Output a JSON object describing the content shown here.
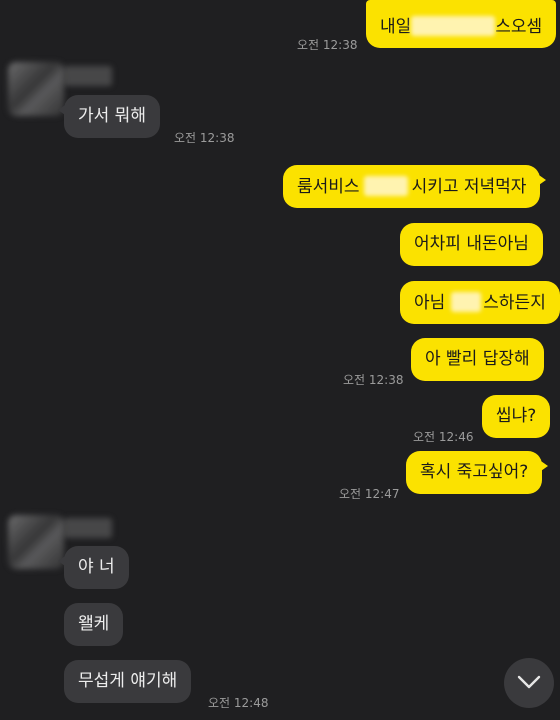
{
  "messages": [
    {
      "side": "me",
      "parts": [
        "내일",
        "",
        "스오셈"
      ],
      "time": "오전 12:38"
    },
    {
      "side": "other",
      "text": "가서 뭐해",
      "time": "오전 12:38"
    },
    {
      "side": "me",
      "parts": [
        "룸서비스",
        "",
        "시키고 저녁먹자"
      ]
    },
    {
      "side": "me",
      "text": "어차피 내돈아님"
    },
    {
      "side": "me",
      "parts": [
        "아님",
        "",
        "스하든지"
      ]
    },
    {
      "side": "me",
      "text": "아 빨리 답장해",
      "time": "오전 12:38"
    },
    {
      "side": "me",
      "text": "씹냐?",
      "time": "오전 12:46"
    },
    {
      "side": "me",
      "text": "혹시 죽고싶어?",
      "time": "오전 12:47"
    },
    {
      "side": "other",
      "text": "야 너"
    },
    {
      "side": "other",
      "text": "왤케"
    },
    {
      "side": "other",
      "text": "무섭게 얘기해",
      "time": "오전 12:48"
    }
  ],
  "colors": {
    "background": "#1f1f21",
    "my_bubble": "#fbe200",
    "their_bubble": "#3a3a3d",
    "timestamp": "#9b9b9b"
  },
  "icons": {
    "scroll_down": "chevron-down-icon",
    "avatar": "blurred-avatar"
  }
}
